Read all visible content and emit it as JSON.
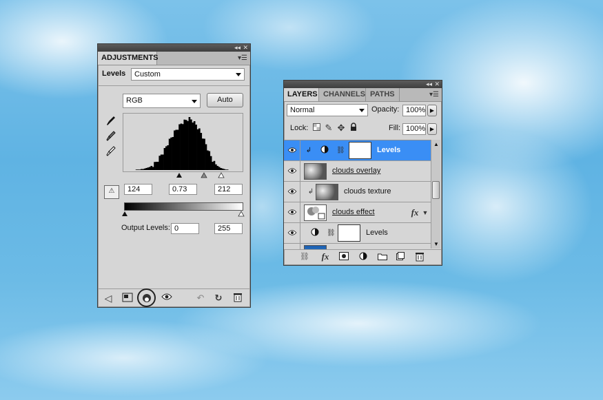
{
  "adjustments": {
    "tab": "ADJUSTMENTS",
    "preset_label": "Levels",
    "preset_value": "Custom",
    "channel_value": "RGB",
    "auto_label": "Auto",
    "input_black": "124",
    "input_gamma": "0.73",
    "input_white": "212",
    "output_label": "Output Levels:",
    "output_black": "0",
    "output_white": "255",
    "histogram": [
      0,
      0,
      1,
      1,
      1,
      2,
      2,
      3,
      4,
      5,
      6,
      8,
      10,
      13,
      16,
      20,
      25,
      30,
      34,
      40,
      46,
      52,
      58,
      63,
      68,
      74,
      78,
      82,
      86,
      90,
      93,
      95,
      97,
      99,
      100,
      98,
      96,
      92,
      88,
      83,
      78,
      72,
      65,
      58,
      50,
      42,
      34,
      27,
      20,
      15,
      11,
      8,
      6,
      4,
      3,
      2,
      1,
      1,
      0,
      0
    ]
  },
  "layers": {
    "tabs": [
      "LAYERS",
      "CHANNELS",
      "PATHS"
    ],
    "blend_mode": "Normal",
    "opacity_label": "Opacity:",
    "opacity_value": "100%",
    "lock_label": "Lock:",
    "fill_label": "Fill:",
    "fill_value": "100%",
    "rows": [
      {
        "name": "Levels",
        "selected": true
      },
      {
        "name": "clouds overlay"
      },
      {
        "name": "clouds texture"
      },
      {
        "name": "clouds effect"
      },
      {
        "name": "Levels"
      }
    ]
  },
  "colors": {
    "selection": "#3a8ef5",
    "panel": "#d6d6d6"
  }
}
